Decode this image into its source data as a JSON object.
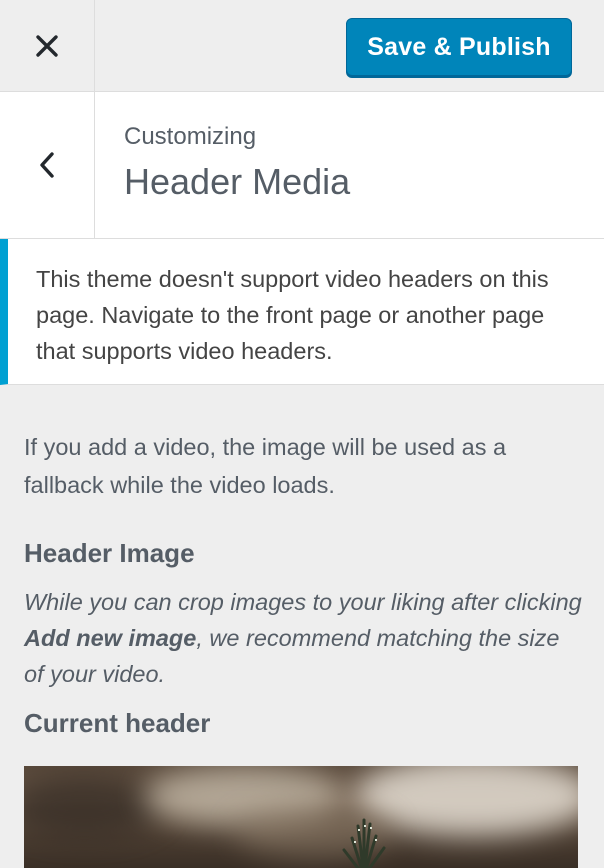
{
  "topbar": {
    "close_icon": "close-icon",
    "publish_label": "Save & Publish",
    "publish_color": "#0085ba"
  },
  "section": {
    "back_icon": "chevron-left-icon",
    "breadcrumb": "Customizing",
    "title": "Header Media"
  },
  "notice": {
    "text": "This theme doesn't support video headers on this page. Navigate to the front page or another page that supports video headers.",
    "accent_color": "#00a0d2"
  },
  "content": {
    "description": "If you add a video, the image will be used as a fallback while the video loads.",
    "header_image_title": "Header Image",
    "note_before": "While you can crop images to your liking after clicking ",
    "note_strong": "Add new image",
    "note_after": ", we recommend matching the size of your video.",
    "current_header_title": "Current header"
  }
}
